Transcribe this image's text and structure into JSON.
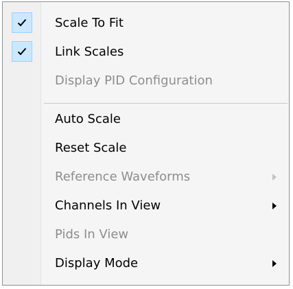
{
  "menu": {
    "items": [
      {
        "label": "Scale To Fit",
        "checked": true,
        "disabled": false,
        "submenu": false
      },
      {
        "label": "Link Scales",
        "checked": true,
        "disabled": false,
        "submenu": false
      },
      {
        "label": "Display PID Configuration",
        "checked": false,
        "disabled": true,
        "submenu": false
      },
      {
        "label": "Auto Scale",
        "checked": false,
        "disabled": false,
        "submenu": false
      },
      {
        "label": "Reset Scale",
        "checked": false,
        "disabled": false,
        "submenu": false
      },
      {
        "label": "Reference Waveforms",
        "checked": false,
        "disabled": true,
        "submenu": true
      },
      {
        "label": "Channels In View",
        "checked": false,
        "disabled": false,
        "submenu": true
      },
      {
        "label": "Pids In View",
        "checked": false,
        "disabled": true,
        "submenu": false
      },
      {
        "label": "Display Mode",
        "checked": false,
        "disabled": false,
        "submenu": true
      }
    ]
  },
  "colors": {
    "menu_background": "#f5f5f5",
    "check_highlight": "#cce8ff",
    "check_border": "#99d1ff",
    "disabled_text": "#8d8d8d"
  },
  "icons": {
    "check": "checkmark-icon",
    "submenu": "chevron-right-icon"
  }
}
